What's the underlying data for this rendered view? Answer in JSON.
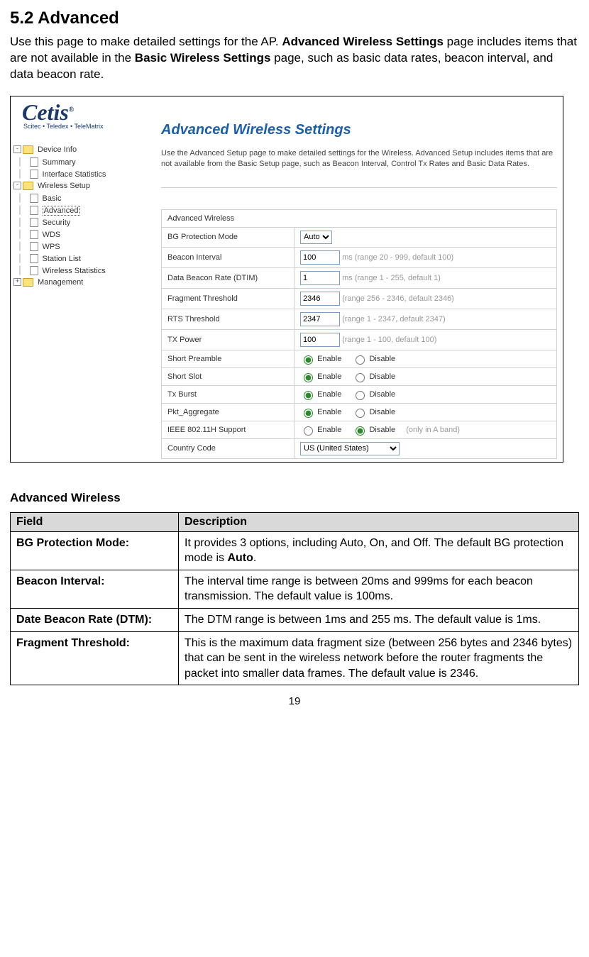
{
  "heading": "5.2  Advanced",
  "intro_parts": {
    "p1": "Use this page to make detailed settings for the AP. ",
    "p2": "Advanced Wireless Settings",
    "p3": " page includes items that are not available in the ",
    "p4": "Basic Wireless Settings",
    "p5": " page, such as basic data rates, beacon interval, and data beacon rate."
  },
  "logo": {
    "brand": "Cetis",
    "sub": "Scitec • Teledex • TeleMatrix"
  },
  "nav": {
    "items": [
      {
        "kind": "folder",
        "exp": "-",
        "label": "Device Info",
        "indent": 0
      },
      {
        "kind": "page",
        "label": "Summary",
        "indent": 1
      },
      {
        "kind": "page",
        "label": "Interface Statistics",
        "indent": 1
      },
      {
        "kind": "folder",
        "exp": "-",
        "label": "Wireless Setup",
        "indent": 0
      },
      {
        "kind": "page",
        "label": "Basic",
        "indent": 1
      },
      {
        "kind": "page",
        "label": "Advanced",
        "indent": 1,
        "selected": true
      },
      {
        "kind": "page",
        "label": "Security",
        "indent": 1
      },
      {
        "kind": "page",
        "label": "WDS",
        "indent": 1
      },
      {
        "kind": "page",
        "label": "WPS",
        "indent": 1
      },
      {
        "kind": "page",
        "label": "Station List",
        "indent": 1
      },
      {
        "kind": "page",
        "label": "Wireless Statistics",
        "indent": 1
      },
      {
        "kind": "folder",
        "exp": "+",
        "label": "Management",
        "indent": 0
      }
    ]
  },
  "panel": {
    "title": "Advanced Wireless Settings",
    "desc": "Use the Advanced Setup page to make detailed settings for the Wireless. Advanced Setup includes items that are not available from the Basic Setup page, such as Beacon Interval, Control Tx Rates and Basic Data Rates.",
    "section_label": "Advanced Wireless",
    "rows": {
      "bg": {
        "label": "BG Protection Mode",
        "value": "Auto"
      },
      "beacon": {
        "label": "Beacon Interval",
        "value": "100",
        "hint": "ms (range 20 - 999, default 100)"
      },
      "dtim": {
        "label": "Data Beacon Rate (DTIM)",
        "value": "1",
        "hint": "ms (range 1 - 255, default 1)"
      },
      "frag": {
        "label": "Fragment Threshold",
        "value": "2346",
        "hint": "(range 256 - 2346, default 2346)"
      },
      "rts": {
        "label": "RTS Threshold",
        "value": "2347",
        "hint": "(range 1 - 2347, default 2347)"
      },
      "txp": {
        "label": "TX Power",
        "value": "100",
        "hint": "(range 1 - 100, default 100)"
      },
      "pre": {
        "label": "Short Preamble",
        "enable": "Enable",
        "disable": "Disable",
        "sel": "enable"
      },
      "slot": {
        "label": "Short Slot",
        "enable": "Enable",
        "disable": "Disable",
        "sel": "enable"
      },
      "burst": {
        "label": "Tx Burst",
        "enable": "Enable",
        "disable": "Disable",
        "sel": "enable"
      },
      "pkt": {
        "label": "Pkt_Aggregate",
        "enable": "Enable",
        "disable": "Disable",
        "sel": "enable"
      },
      "ieee": {
        "label": "IEEE 802.11H Support",
        "enable": "Enable",
        "disable": "Disable",
        "sel": "disable",
        "hint": "(only in A band)"
      },
      "cc": {
        "label": "Country Code",
        "value": "US (United States)"
      }
    }
  },
  "desc_section_title": "Advanced Wireless",
  "desc_table": {
    "col_field": "Field",
    "col_desc": "Description",
    "rows": [
      {
        "field": "BG Protection Mode:",
        "desc_pre": "It provides 3 options, including Auto, On, and Off. The default BG protection mode is ",
        "desc_bold": "Auto",
        "desc_post": "."
      },
      {
        "field": "Beacon Interval:",
        "desc": "The interval time range is between 20ms and 999ms for each beacon transmission. The default value is 100ms."
      },
      {
        "field": "Date Beacon Rate (DTM):",
        "desc": "The DTM range is between 1ms and 255 ms.  The default value is 1ms."
      },
      {
        "field": "Fragment Threshold:",
        "desc": "This is the maximum data fragment size (between 256 bytes and 2346 bytes) that can be sent in the wireless network before the router fragments the packet into smaller data frames. The default value is 2346."
      }
    ]
  },
  "page_number": "19"
}
